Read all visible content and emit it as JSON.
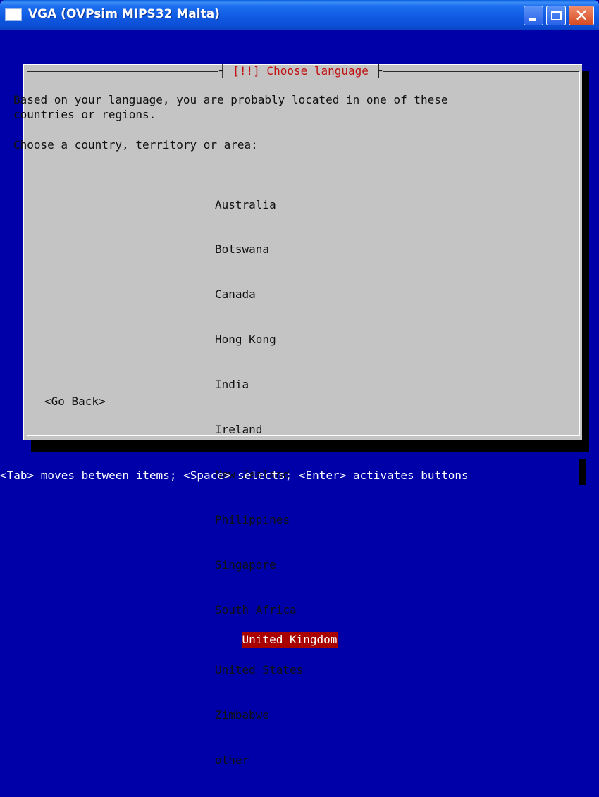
{
  "window": {
    "title": "VGA (OVPsim MIPS32 Malta)",
    "buttons": {
      "minimize_icon": "minimize-icon",
      "maximize_icon": "maximize-icon",
      "close_glyph": "✕"
    }
  },
  "dialog": {
    "title_left": "┤ ",
    "title": "[!!] Choose language",
    "title_right": " ├",
    "intro_text": "Based on your language, you are probably located in one of these\ncountries or regions.",
    "prompt": "Choose a country, territory or area:",
    "countries": [
      "Australia",
      "Botswana",
      "Canada",
      "Hong Kong",
      "India",
      "Ireland",
      "New Zealand",
      "Philippines",
      "Singapore",
      "South Africa",
      "United Kingdom",
      "United States",
      "Zimbabwe",
      "other"
    ],
    "selected_country": "United Kingdom",
    "go_back_label": "<Go Back>"
  },
  "help_line": "<Tab> moves between items; <Space> selects; <Enter> activates buttons",
  "colors": {
    "console_background": "#0000a8",
    "dialog_background": "#c4c4c4",
    "title_accent": "#c01010",
    "selection_background": "#a80000"
  }
}
